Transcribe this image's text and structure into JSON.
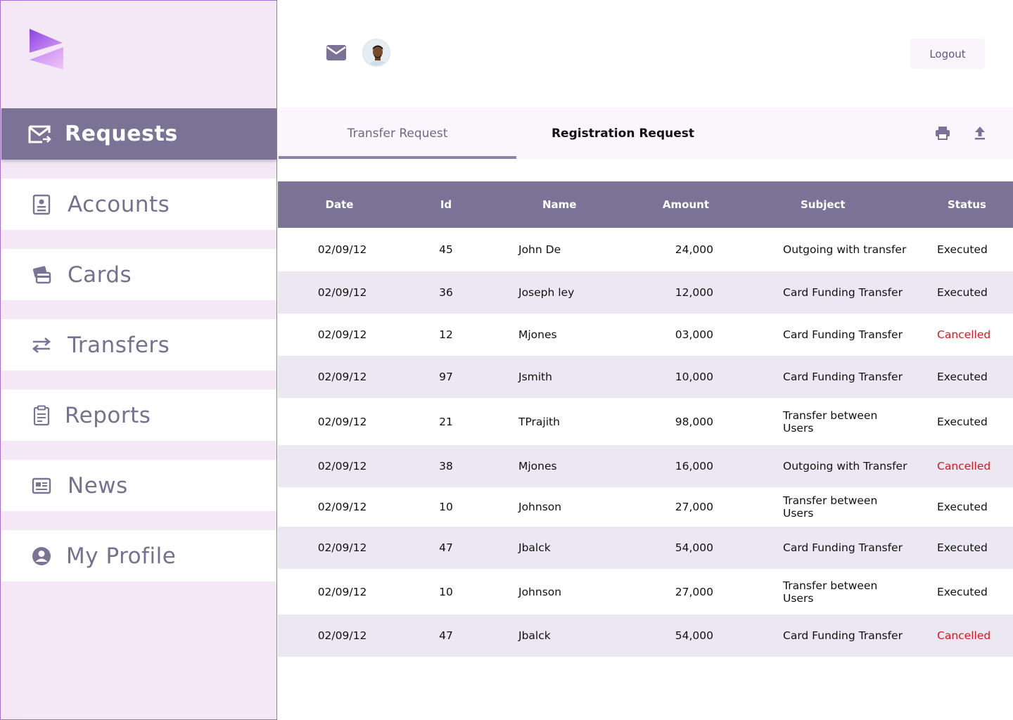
{
  "sidebar": {
    "items": [
      {
        "key": "requests",
        "label": "Requests",
        "icon": "mail-send-icon",
        "active": true
      },
      {
        "key": "accounts",
        "label": "Accounts",
        "icon": "id-card-icon",
        "active": false
      },
      {
        "key": "cards",
        "label": "Cards",
        "icon": "credit-card-icon",
        "active": false
      },
      {
        "key": "transfers",
        "label": "Transfers",
        "icon": "transfer-arrows-icon",
        "active": false
      },
      {
        "key": "reports",
        "label": "Reports",
        "icon": "clipboard-icon",
        "active": false
      },
      {
        "key": "news",
        "label": "News",
        "icon": "newspaper-icon",
        "active": false
      },
      {
        "key": "profile",
        "label": "My Profile",
        "icon": "user-circle-icon",
        "active": false
      }
    ]
  },
  "header": {
    "logout_label": "Logout"
  },
  "tabs": {
    "transfer_label": "Transfer Request",
    "registration_label": "Registration Request"
  },
  "table": {
    "columns": [
      "Date",
      "Id",
      "Name",
      "Amount",
      "Subject",
      "Status"
    ],
    "rows": [
      {
        "date": "02/09/12",
        "id": "45",
        "name": "John De",
        "amount": "24,000",
        "subject": "Outgoing with transfer",
        "status": "Executed"
      },
      {
        "date": "02/09/12",
        "id": "36",
        "name": "Joseph ley",
        "amount": "12,000",
        "subject": "Card Funding Transfer",
        "status": "Executed"
      },
      {
        "date": "02/09/12",
        "id": "12",
        "name": "Mjones",
        "amount": "03,000",
        "subject": "Card Funding Transfer",
        "status": "Cancelled"
      },
      {
        "date": "02/09/12",
        "id": "97",
        "name": "Jsmith",
        "amount": "10,000",
        "subject": "Card Funding Transfer",
        "status": "Executed"
      },
      {
        "date": "02/09/12",
        "id": "21",
        "name": "TPrajith",
        "amount": "98,000",
        "subject": "Transfer between Users",
        "status": "Executed"
      },
      {
        "date": "02/09/12",
        "id": "38",
        "name": "Mjones",
        "amount": "16,000",
        "subject": "Outgoing with Transfer",
        "status": "Cancelled"
      },
      {
        "date": "02/09/12",
        "id": "10",
        "name": "Johnson",
        "amount": "27,000",
        "subject": "Transfer between Users",
        "status": "Executed"
      },
      {
        "date": "02/09/12",
        "id": "47",
        "name": "Jbalck",
        "amount": "54,000",
        "subject": "Card Funding Transfer",
        "status": "Executed"
      },
      {
        "date": "02/09/12",
        "id": "10",
        "name": "Johnson",
        "amount": "27,000",
        "subject": "Transfer between Users",
        "status": "Executed"
      },
      {
        "date": "02/09/12",
        "id": "47",
        "name": "Jbalck",
        "amount": "54,000",
        "subject": "Card Funding Transfer",
        "status": "Cancelled"
      }
    ]
  },
  "colors": {
    "accent": "#7a7396",
    "sidebar_bg": "#f4e8f6",
    "cancelled": "#e0151b",
    "row_alt": "#ebe8f3"
  }
}
